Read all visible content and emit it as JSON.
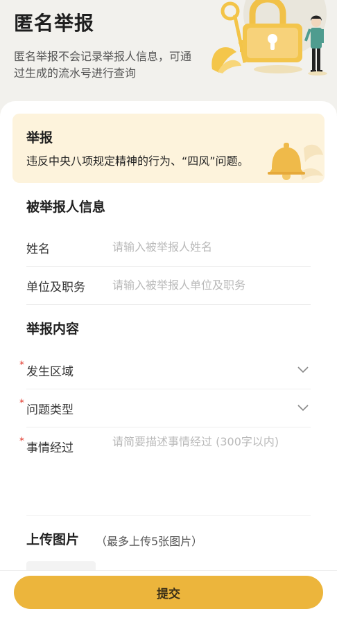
{
  "header": {
    "title": "匿名举报",
    "description": "匿名举报不会记录举报人信息，可通过生成的流水号进行查询"
  },
  "notice": {
    "title": "举报",
    "text": "违反中央八项规定精神的行为、“四风”问题。"
  },
  "reported_section": {
    "title": "被举报人信息",
    "fields": [
      {
        "label": "姓名",
        "placeholder": "请输入被举报人姓名",
        "value": ""
      },
      {
        "label": "单位及职务",
        "placeholder": "请输入被举报人单位及职务",
        "value": ""
      }
    ]
  },
  "content_section": {
    "title": "举报内容",
    "required_mark": "*",
    "area_label": "发生区域",
    "type_label": "问题类型",
    "details_label": "事情经过",
    "details_placeholder": "请简要描述事情经过 (300字以内)"
  },
  "upload": {
    "title": "上传图片",
    "hint": "（最多上传5张图片）"
  },
  "submit_label": "提交",
  "colors": {
    "accent": "#ecb53c",
    "notice_bg": "#fdf3dc",
    "required": "#e23a2e",
    "page_bg": "#f2f1ed"
  }
}
